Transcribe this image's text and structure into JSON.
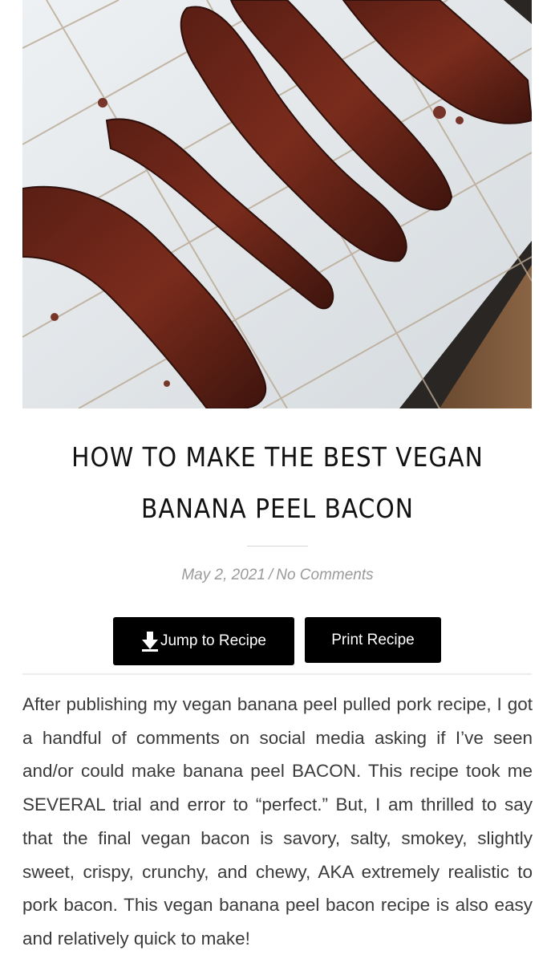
{
  "hero": {
    "image_name": "banana-peel-bacon-photo"
  },
  "article": {
    "title": "HOW TO MAKE THE BEST VEGAN BANANA PEEL BACON",
    "date": "May 2, 2021",
    "separator": "/",
    "comments": "No Comments",
    "body": "After publishing my vegan banana peel pulled pork recipe, I got a handful of comments on social media asking if I’ve seen and/or could make banana peel BACON. This recipe took me SEVERAL trial and error to “perfect.” But, I am thrilled to say that the final vegan bacon is savory, salty, smokey, slightly sweet, crispy, crunchy, and chewy, AKA extremely realistic to pork bacon. This vegan banana peel bacon recipe is also easy and relatively quick to make!"
  },
  "buttons": {
    "jump_label": "Jump to Recipe",
    "jump_icon": "arrow-down-icon",
    "print_label": "Print Recipe"
  },
  "colors": {
    "button_bg": "#000000",
    "button_text": "#ffffff",
    "meta_text": "#9a9a9a",
    "body_text": "#3a3a3a"
  }
}
